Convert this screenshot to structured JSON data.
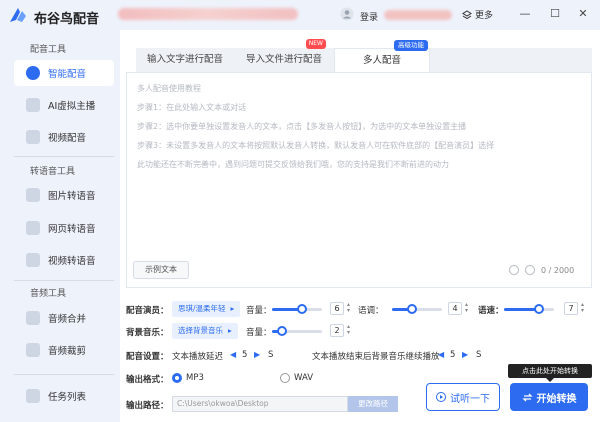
{
  "titlebar": {
    "app_name": "布谷鸟配音",
    "login": "登录",
    "more": "更多",
    "minimize": "—",
    "maximize": "☐",
    "close": "✕"
  },
  "sidebar": {
    "section_dubbing": "配音工具",
    "section_convert": "转语音工具",
    "section_audio": "音频工具",
    "items": [
      {
        "label": "智能配音",
        "icon": "smart-dub-icon",
        "active": true
      },
      {
        "label": "AI虚拟主播",
        "icon": "ai-anchor-icon"
      },
      {
        "label": "视频配音",
        "icon": "video-dub-icon"
      },
      {
        "label": "图片转语音",
        "icon": "image-to-speech-icon"
      },
      {
        "label": "网页转语音",
        "icon": "web-to-speech-icon"
      },
      {
        "label": "视频转语音",
        "icon": "video-to-speech-icon"
      },
      {
        "label": "音频合并",
        "icon": "audio-merge-icon"
      },
      {
        "label": "音频裁剪",
        "icon": "audio-cut-icon"
      },
      {
        "label": "任务列表",
        "icon": "task-list-icon"
      }
    ]
  },
  "tabs": {
    "tab1": "输入文字进行配音",
    "tab2": "导入文件进行配音",
    "tab2_badge": "NEW",
    "tab3": "多人配音",
    "tab3_badge": "高级功能"
  },
  "editor": {
    "line0": "多人配音使用教程",
    "line1": "步骤1：在此处输入文本或对话",
    "line2": "步骤2：选中你要单独设置发音人的文本，点击【多发音人按钮】，为选中的文本单独设置主播",
    "line3": "步骤3：未设置多发音人的文本将按照默认发音人转换，默认发音人可在软件底部的【配音演员】选择",
    "line4": "此功能还在不断完善中，遇到问题可提交反馈给我们哦，您的支持是我们不断前进的动力",
    "example_button": "示例文本",
    "char_count": "0 / 2000"
  },
  "settings": {
    "voice_label": "配音演员：",
    "voice_value": "思琪/温柔年轻",
    "volume_label": "音量：",
    "volume_value": "6",
    "volume_level": 0.6,
    "tone_label": "语调：",
    "tone_value": "4",
    "tone_level": 0.4,
    "speed_label": "语速：",
    "speed_value": "7",
    "speed_level": 0.7,
    "bgm_label": "背景音乐：",
    "bgm_value": "选择背景音乐",
    "bgm_volume_label": "音量：",
    "bgm_volume_value": "2",
    "bgm_volume_level": 0.2,
    "dub_settings_label": "配音设置：",
    "delay_label": "文本播放延迟",
    "delay_value": "5",
    "delay_unit": "S",
    "bgm_continue_label": "文本播放结束后背景音乐继续播放",
    "bgm_continue_value": "5",
    "bgm_continue_unit": "S",
    "format_label": "输出格式：",
    "format_mp3": "MP3",
    "format_wav": "WAV",
    "path_label": "输出路径：",
    "path_value": "C:\\Users\\okwoa\\Desktop",
    "path_button": "更改路径"
  },
  "actions": {
    "listen": "试听一下",
    "start": "开始转换",
    "tooltip": "点击此处开始转换"
  },
  "colors": {
    "accent": "#2d6bf0",
    "sidebar_bg": "#eef2fb"
  }
}
